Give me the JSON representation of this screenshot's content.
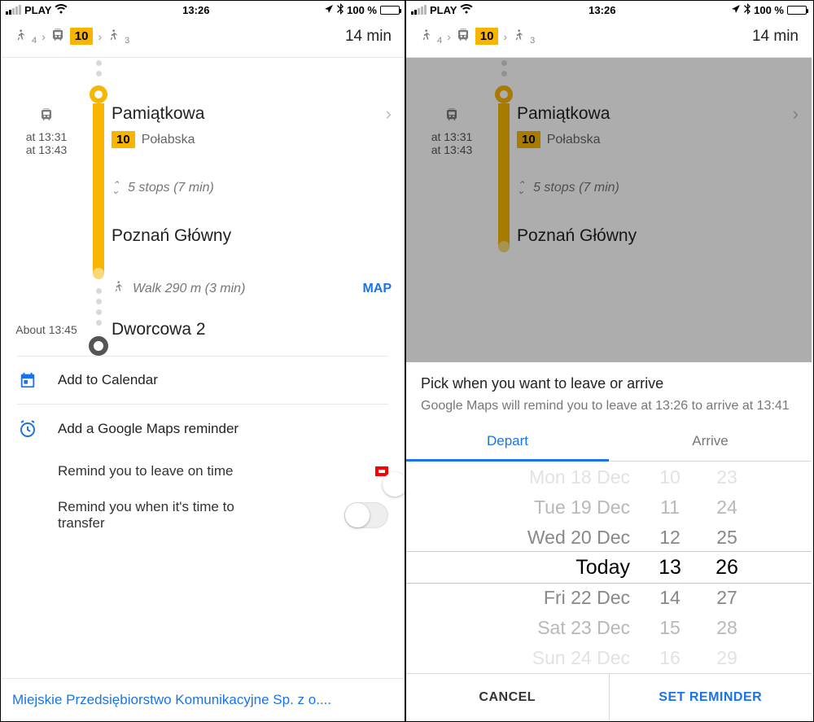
{
  "status": {
    "carrier": "PLAY",
    "time": "13:26",
    "battery_pct": "100 %"
  },
  "header": {
    "walk1_sub": "4",
    "line": "10",
    "walk2_sub": "3",
    "duration": "14 min"
  },
  "screen1": {
    "board": {
      "stop": "Pamiątkowa",
      "times": [
        "at 13:31",
        "at 13:43"
      ],
      "direction": "Połabska",
      "line": "10"
    },
    "ride": {
      "summary": "5 stops (7 min)"
    },
    "alight": {
      "stop": "Poznań Główny"
    },
    "walk": {
      "text": "Walk 290 m (3 min)",
      "map_label": "MAP"
    },
    "arrive": {
      "about": "About 13:45",
      "stop": "Dworcowa 2"
    },
    "actions": {
      "calendar": "Add to Calendar",
      "reminder": "Add a Google Maps reminder",
      "remind_leave": "Remind you to leave on time",
      "remind_transfer": "Remind you when it's time to transfer"
    },
    "footer": "Miejskie Przedsiębiorstwo Komunikacyjne Sp. z o...."
  },
  "sheet": {
    "title": "Pick when you want to leave or arrive",
    "subtitle": "Google Maps will remind you to leave at 13:26 to arrive at 13:41",
    "tab_depart": "Depart",
    "tab_arrive": "Arrive",
    "picker": {
      "dates": [
        "Mon 18 Dec",
        "Tue 19 Dec",
        "Wed 20 Dec",
        "Today",
        "Fri 22 Dec",
        "Sat 23 Dec",
        "Sun 24 Dec"
      ],
      "hours": [
        "10",
        "11",
        "12",
        "13",
        "14",
        "15",
        "16"
      ],
      "minutes": [
        "23",
        "24",
        "25",
        "26",
        "27",
        "28",
        "29"
      ]
    },
    "cancel": "CANCEL",
    "set": "SET REMINDER"
  }
}
